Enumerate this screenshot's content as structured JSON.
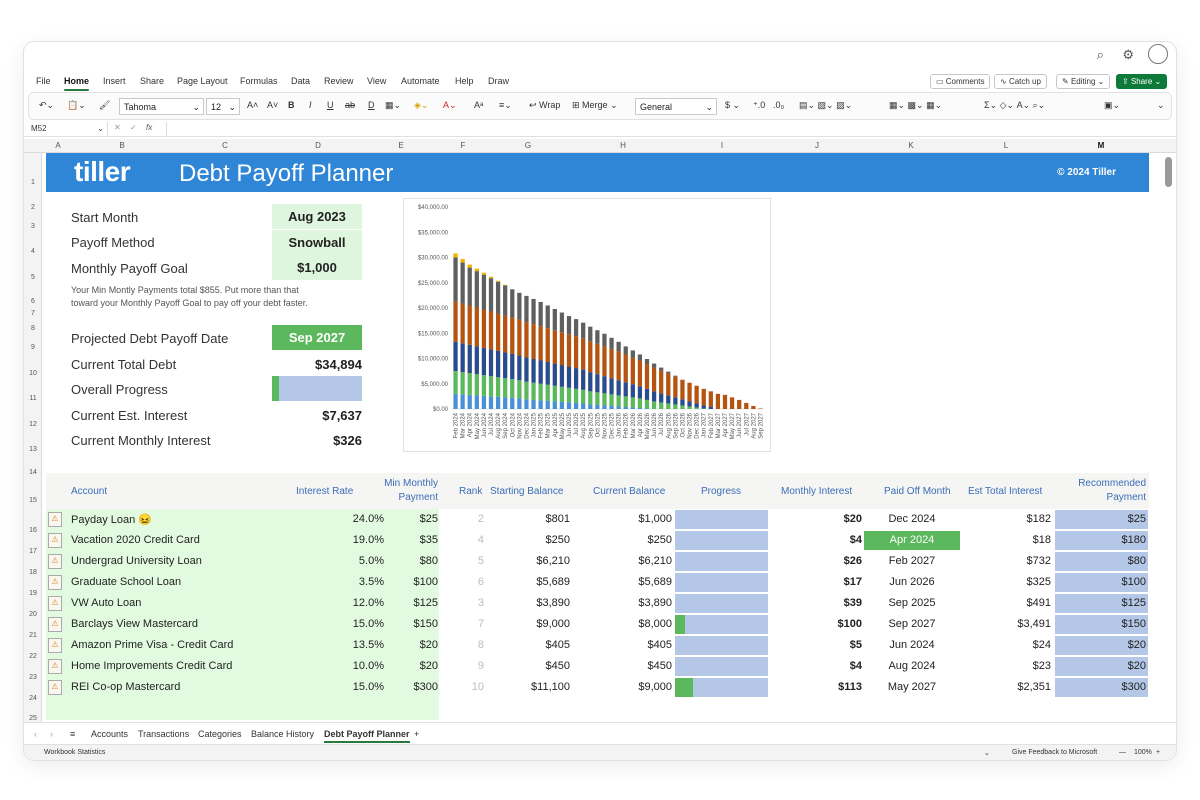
{
  "titlebar": {
    "search_icon": "search-icon",
    "settings_icon": "gear-icon"
  },
  "menu": [
    "File",
    "Home",
    "Insert",
    "Share",
    "Page Layout",
    "Formulas",
    "Data",
    "Review",
    "View",
    "Automate",
    "Help",
    "Draw"
  ],
  "menu_active": "Home",
  "actions": {
    "comments": "Comments",
    "catchup": "Catch up",
    "editing": "Editing",
    "share": "Share"
  },
  "ribbon": {
    "font": "Tahoma",
    "size": "12",
    "wrap": "Wrap",
    "merge": "Merge",
    "number_format": "General"
  },
  "namebox": "M52",
  "fx": "fx",
  "columns": [
    "A",
    "B",
    "C",
    "D",
    "E",
    "F",
    "G",
    "H",
    "I",
    "J",
    "K",
    "L",
    "M"
  ],
  "selected_column": "M",
  "rows": [
    "1",
    "2",
    "3",
    "4",
    "5",
    "6",
    "7",
    "8",
    "9",
    "10",
    "11",
    "12",
    "13",
    "14",
    "15",
    "16",
    "17",
    "18",
    "19",
    "20",
    "21",
    "22",
    "23",
    "24",
    "25"
  ],
  "banner": {
    "logo": "tiller",
    "title": "Debt Payoff Planner",
    "copyright": "© 2024 Tiller"
  },
  "summary": {
    "start_month_label": "Start Month",
    "start_month": "Aug 2023",
    "method_label": "Payoff Method",
    "method": "Snowball",
    "goal_label": "Monthly Payoff Goal",
    "goal": "$1,000",
    "note_line1": "Your Min Montly Payments total $855. Put more than that",
    "note_line2": "toward your Monthly Payoff Goal to pay off your debt faster.",
    "payoff_date_label": "Projected Debt Payoff Date",
    "payoff_date": "Sep 2027",
    "total_debt_label": "Current Total Debt",
    "total_debt": "$34,894",
    "progress_label": "Overall Progress",
    "progress_fraction": 0.08,
    "interest_label": "Current Est. Interest",
    "interest": "$7,637",
    "monthly_interest_label": "Current Monthly Interest",
    "monthly_interest": "$326"
  },
  "table": {
    "headers": {
      "account": "Account",
      "rate": "Interest Rate",
      "min1": "Min Monthly",
      "min2": "Payment",
      "rank": "Rank",
      "starting": "Starting Balance",
      "current": "Current Balance",
      "progress": "Progress",
      "monthly_interest": "Monthly Interest",
      "paid_off": "Paid Off Month",
      "est_interest": "Est Total Interest",
      "rec1": "Recommended",
      "rec2": "Payment"
    },
    "rows": [
      {
        "account": "Payday Loan 😖",
        "rate": "24.0%",
        "min": "$25",
        "rank": "2",
        "start": "$801",
        "current": "$1,000",
        "progress": 0,
        "mint": "$20",
        "paid": "Dec 2024",
        "est": "$182",
        "rec": "$25"
      },
      {
        "account": "Vacation 2020 Credit Card",
        "rate": "19.0%",
        "min": "$35",
        "rank": "4",
        "start": "$250",
        "current": "$250",
        "progress": 0,
        "mint": "$4",
        "paid": "Apr 2024",
        "paid_highlight": true,
        "est": "$18",
        "rec": "$180"
      },
      {
        "account": "Undergrad University Loan",
        "rate": "5.0%",
        "min": "$80",
        "rank": "5",
        "start": "$6,210",
        "current": "$6,210",
        "progress": 0,
        "mint": "$26",
        "paid": "Feb 2027",
        "est": "$732",
        "rec": "$80"
      },
      {
        "account": "Graduate School Loan",
        "rate": "3.5%",
        "min": "$100",
        "rank": "6",
        "start": "$5,689",
        "current": "$5,689",
        "progress": 0,
        "mint": "$17",
        "paid": "Jun 2026",
        "est": "$325",
        "rec": "$100"
      },
      {
        "account": "VW Auto Loan",
        "rate": "12.0%",
        "min": "$125",
        "rank": "3",
        "start": "$3,890",
        "current": "$3,890",
        "progress": 0,
        "mint": "$39",
        "paid": "Sep 2025",
        "est": "$491",
        "rec": "$125"
      },
      {
        "account": "Barclays View Mastercard",
        "rate": "15.0%",
        "min": "$150",
        "rank": "7",
        "start": "$9,000",
        "current": "$8,000",
        "progress": 0.11,
        "mint": "$100",
        "paid": "Sep 2027",
        "est": "$3,491",
        "rec": "$150"
      },
      {
        "account": "Amazon Prime Visa - Credit Card",
        "rate": "13.5%",
        "min": "$20",
        "rank": "8",
        "start": "$405",
        "current": "$405",
        "progress": 0,
        "mint": "$5",
        "paid": "Jun 2024",
        "est": "$24",
        "rec": "$20"
      },
      {
        "account": "Home Improvements Credit Card",
        "rate": "10.0%",
        "min": "$20",
        "rank": "9",
        "start": "$450",
        "current": "$450",
        "progress": 0,
        "mint": "$4",
        "paid": "Aug 2024",
        "est": "$23",
        "rec": "$20"
      },
      {
        "account": "REI Co-op Mastercard",
        "rate": "15.0%",
        "min": "$300",
        "rank": "10",
        "start": "$11,100",
        "current": "$9,000",
        "progress": 0.19,
        "mint": "$113",
        "paid": "May 2027",
        "est": "$2,351",
        "rec": "$300"
      }
    ]
  },
  "chart_data": {
    "type": "bar",
    "stacked": true,
    "ylim": [
      0,
      40000
    ],
    "y_ticks": [
      "$0.00",
      "$5,000.00",
      "$10,000.00",
      "$15,000.00",
      "$20,000.00",
      "$25,000.00",
      "$30,000.00",
      "$35,000.00",
      "$40,000.00"
    ],
    "categories": [
      "Feb 2024",
      "Mar 2024",
      "Apr 2024",
      "May 2024",
      "Jun 2024",
      "Jul 2024",
      "Aug 2024",
      "Sep 2024",
      "Oct 2024",
      "Nov 2024",
      "Dec 2024",
      "Jan 2025",
      "Feb 2025",
      "Mar 2025",
      "Apr 2025",
      "May 2025",
      "Jun 2025",
      "Jul 2025",
      "Aug 2025",
      "Sep 2025",
      "Oct 2025",
      "Nov 2025",
      "Dec 2025",
      "Jan 2026",
      "Feb 2026",
      "Mar 2026",
      "Apr 2026",
      "May 2026",
      "Jun 2026",
      "Jul 2026",
      "Aug 2026",
      "Sep 2026",
      "Oct 2026",
      "Nov 2026",
      "Dec 2026",
      "Jan 2027",
      "Feb 2027",
      "Mar 2027",
      "Apr 2027",
      "May 2027",
      "Jun 2027",
      "Jul 2027",
      "Aug 2027",
      "Sep 2027"
    ],
    "series": [
      {
        "color": "#4a90d9",
        "values": [
          3000,
          2900,
          2800,
          2700,
          2600,
          2500,
          2400,
          2300,
          2200,
          2100,
          1900,
          1800,
          1700,
          1600,
          1500,
          1400,
          1300,
          1200,
          1100,
          900,
          800,
          700,
          600,
          500,
          400,
          300,
          200,
          100,
          0,
          0,
          0,
          0,
          0,
          0,
          0,
          0,
          0,
          0,
          0,
          0,
          0,
          0,
          0,
          0
        ]
      },
      {
        "color": "#5cb85c",
        "values": [
          4500,
          4400,
          4300,
          4200,
          4100,
          4000,
          3900,
          3800,
          3700,
          3600,
          3500,
          3400,
          3300,
          3200,
          3100,
          3000,
          2900,
          2800,
          2700,
          2600,
          2500,
          2400,
          2300,
          2200,
          2100,
          2000,
          1900,
          1700,
          1500,
          1300,
          1100,
          900,
          700,
          500,
          300,
          100,
          0,
          0,
          0,
          0,
          0,
          0,
          0,
          0
        ]
      },
      {
        "color": "#2a4b8d",
        "values": [
          5800,
          5700,
          5600,
          5500,
          5400,
          5300,
          5200,
          5100,
          5000,
          4900,
          4800,
          4700,
          4600,
          4500,
          4400,
          4300,
          4200,
          4100,
          4000,
          3800,
          3600,
          3400,
          3200,
          3000,
          2800,
          2600,
          2400,
          2200,
          2000,
          1800,
          1600,
          1400,
          1200,
          1000,
          800,
          600,
          400,
          0,
          0,
          0,
          0,
          0,
          0,
          0
        ]
      },
      {
        "color": "#b5530f",
        "values": [
          8000,
          7900,
          7800,
          7700,
          7600,
          7500,
          7400,
          7300,
          7200,
          7100,
          7000,
          6900,
          6800,
          6700,
          6600,
          6500,
          6400,
          6300,
          6200,
          6100,
          6000,
          5900,
          5800,
          5700,
          5500,
          5300,
          5100,
          4900,
          4700,
          4500,
          4300,
          4100,
          3900,
          3700,
          3500,
          3300,
          3100,
          3000,
          2800,
          2300,
          1800,
          1200,
          600,
          100
        ]
      },
      {
        "color": "#5f5f5f",
        "values": [
          8700,
          8100,
          7500,
          7200,
          6900,
          6600,
          6300,
          6000,
          5600,
          5300,
          5200,
          5000,
          4800,
          4500,
          4200,
          3900,
          3600,
          3400,
          3100,
          2900,
          2700,
          2500,
          2200,
          1900,
          1600,
          1400,
          1200,
          1000,
          800,
          600,
          400,
          200,
          0,
          0,
          0,
          0,
          0,
          0,
          0,
          0,
          0,
          0,
          0,
          0
        ]
      },
      {
        "color": "#f0b400",
        "values": [
          800,
          700,
          600,
          500,
          400,
          300,
          200,
          100,
          0,
          0,
          0,
          0,
          0,
          0,
          0,
          0,
          0,
          0,
          0,
          0,
          0,
          0,
          0,
          0,
          0,
          0,
          0,
          0,
          0,
          0,
          0,
          0,
          0,
          0,
          0,
          0,
          0,
          0,
          0,
          0,
          0,
          0,
          0,
          0
        ]
      }
    ]
  },
  "sheet_tabs": [
    "Accounts",
    "Transactions",
    "Categories",
    "Balance History",
    "Debt Payoff Planner"
  ],
  "sheet_active": "Debt Payoff Planner",
  "status": {
    "left": "Workbook Statistics",
    "feedback": "Give Feedback to Microsoft",
    "zoom": "100%"
  }
}
